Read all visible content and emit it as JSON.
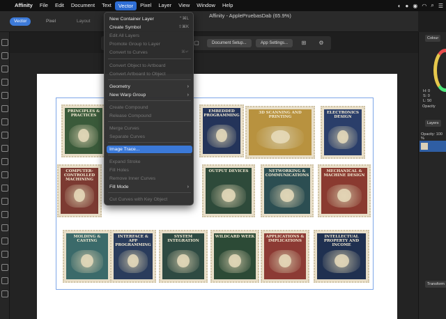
{
  "menubar": {
    "items": [
      "Affinity",
      "File",
      "Edit",
      "Document",
      "Text",
      "Vector",
      "Pixel",
      "Layer",
      "View",
      "Window",
      "Help"
    ],
    "active": "Vector"
  },
  "window": {
    "title": "Affinity - ApplePruebasDab (65.9%)"
  },
  "personas": {
    "vector": "Vector",
    "pixel": "Pixel",
    "layout": "Layout"
  },
  "context_toolbar": {
    "document_setup": "Document Setup...",
    "app_settings": "App Settings..."
  },
  "vector_menu": {
    "items": [
      {
        "label": "New Container Layer",
        "shortcut": "⌃⌘L",
        "disabled": false
      },
      {
        "label": "Create Symbol",
        "shortcut": "⇧⌘K",
        "disabled": false
      },
      {
        "label": "Edit All Layers",
        "disabled": true
      },
      {
        "label": "Promote Group to Layer",
        "disabled": true
      },
      {
        "label": "Convert to Curves",
        "shortcut": "⌘↵",
        "disabled": true
      },
      {
        "label": "Convert Object to Artboard",
        "disabled": true
      },
      {
        "label": "Convert Artboard to Object",
        "disabled": true
      },
      {
        "label": "Geometry",
        "submenu": true
      },
      {
        "label": "New Warp Group",
        "submenu": true
      },
      {
        "label": "Create Compound",
        "disabled": true
      },
      {
        "label": "Release Compound",
        "disabled": true
      },
      {
        "label": "Merge Curves",
        "disabled": true
      },
      {
        "label": "Separate Curves",
        "disabled": true
      },
      {
        "label": "Image Trace...",
        "highlighted": true
      },
      {
        "label": "Expand Stroke",
        "disabled": true
      },
      {
        "label": "Fill Holes",
        "disabled": true
      },
      {
        "label": "Remove Inner Curves",
        "disabled": true
      },
      {
        "label": "Fill Mode",
        "submenu": true
      },
      {
        "label": "Cut Curves with Key Object",
        "disabled": true
      }
    ]
  },
  "stamps": [
    {
      "title": "PRINCIPLES & PRACTICES",
      "color": "#3a5a3a"
    },
    {
      "title": "EMBEDDED PROGRAMMING",
      "color": "#24345a"
    },
    {
      "title": "3D SCANNING AND PRINTING",
      "color": "#b8923f"
    },
    {
      "title": "ELECTRONICS DESIGN",
      "color": "#2a3e6a"
    },
    {
      "title": "COMPUTER-CONTROLLED MACHINING",
      "color": "#7c3a32"
    },
    {
      "title": "OUTPUT DEVICES",
      "color": "#2e4a3a"
    },
    {
      "title": "NETWORKING & COMMUNICATIONS",
      "color": "#2c4e52"
    },
    {
      "title": "MECHANICAL & MACHINE DESIGN",
      "color": "#8a3a30"
    },
    {
      "title": "MOLDING & CASTING",
      "color": "#3b6a6a"
    },
    {
      "title": "INTERFACE & APP PROGRAMMING",
      "color": "#2a3c5c"
    },
    {
      "title": "SYSTEM INTEGRATION",
      "color": "#2e4a42"
    },
    {
      "title": "WILDCARD WEEK",
      "color": "#2c4a36"
    },
    {
      "title": "APPLICATIONS & IMPLICATIONS",
      "color": "#8c3a34"
    },
    {
      "title": "INTELLECTUAL PROPERTY AND INCOME",
      "color": "#1f3050"
    }
  ],
  "right_panel": {
    "colour_tab": "Colour",
    "hsl": {
      "h": "H: 0",
      "s": "S: 0",
      "l": "L: 50"
    },
    "opacity_label": "Opacity",
    "layers_tab": "Layers",
    "layers_opacity": "Opacity: 100 %",
    "transform_tab": "Transform"
  }
}
